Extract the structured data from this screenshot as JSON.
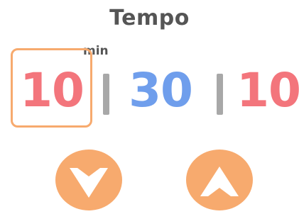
{
  "title": "Tempo",
  "unit_label": "min",
  "fields": [
    {
      "value": "10",
      "color": "#f3757c",
      "selected": true
    },
    {
      "value": "30",
      "color": "#6f9eec",
      "selected": false
    },
    {
      "value": "10",
      "color": "#f3757c",
      "selected": false
    }
  ],
  "separator_char": "|",
  "buttons": {
    "decrease_icon": "chevron-down-icon",
    "increase_icon": "chevron-up-icon",
    "color": "#f7aa6e"
  },
  "colors": {
    "title": "#555555",
    "selection_border": "#f7aa6e",
    "separator": "#a8a8a8"
  }
}
